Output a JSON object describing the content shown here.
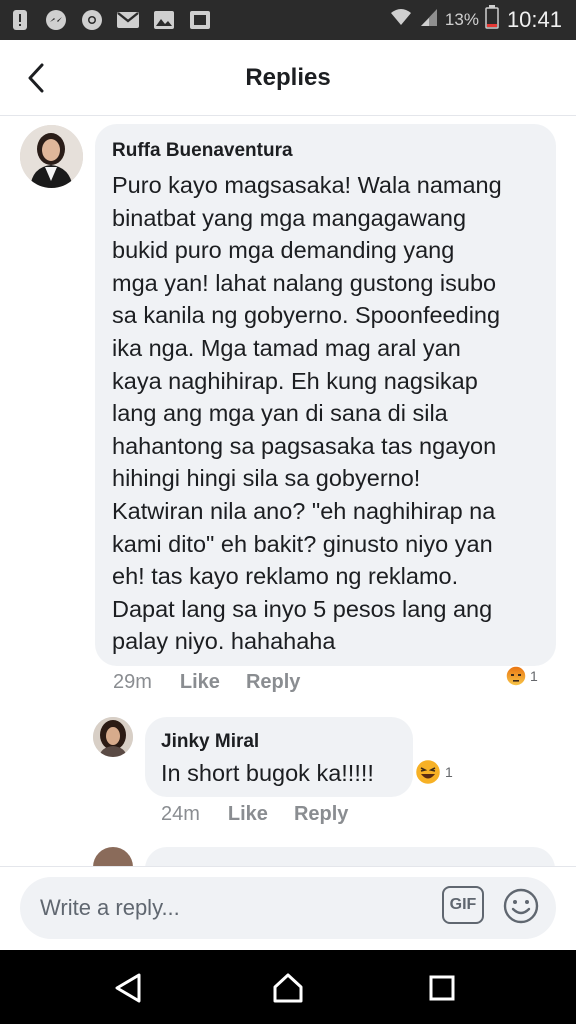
{
  "status_bar": {
    "battery_percent": "13%",
    "time": "10:41",
    "icons": [
      "warning-icon",
      "messenger-icon",
      "chrome-icon",
      "gmail-icon",
      "gallery-icon",
      "photos-icon",
      "wifi-icon",
      "signal-icon",
      "battery-icon"
    ]
  },
  "header": {
    "title": "Replies",
    "back_icon": "back-arrow-icon"
  },
  "comments": [
    {
      "author": "Ruffa Buenaventura",
      "text": "Puro kayo magsasaka! Wala namang\nbinatbat yang mga mangagawang\nbukid puro mga demanding yang\nmga yan! lahat nalang gustong isubo\nsa kanila ng gobyerno. Spoonfeeding\nika nga. Mga tamad mag aral yan\nkaya naghihirap. Eh kung nagsikap\nlang ang mga yan di sana di sila\nhahantong sa pagsasaka tas ngayon\nhihingi hingi sila sa gobyerno!\nKatwiran nila ano? \"eh naghihirap na\nkami dito\" eh bakit? ginusto niyo yan\neh! tas kayo reklamo ng reklamo.\nDapat lang sa inyo 5 pesos lang ang\npalay niyo. hahahaha",
      "time": "29m",
      "like_label": "Like",
      "reply_label": "Reply",
      "reaction": {
        "type": "angry",
        "count": "1",
        "color": "#e9710f"
      }
    },
    {
      "author": "Jinky Miral",
      "text": "In short bugok ka!!!!!",
      "time": "24m",
      "like_label": "Like",
      "reply_label": "Reply",
      "reaction": {
        "type": "haha",
        "count": "1",
        "color": "#f7b125"
      }
    }
  ],
  "reply_box": {
    "placeholder": "Write a reply...",
    "gif_label": "GIF",
    "emoji_icon": "smiley-icon"
  },
  "nav": {
    "icons": [
      "back-triangle-icon",
      "home-icon",
      "recents-icon"
    ]
  },
  "colors": {
    "bubble": "#f0f2f5",
    "meta_text": "#8a8d91",
    "status_bar": "#2b2b2b",
    "nav_bar": "#000000"
  }
}
